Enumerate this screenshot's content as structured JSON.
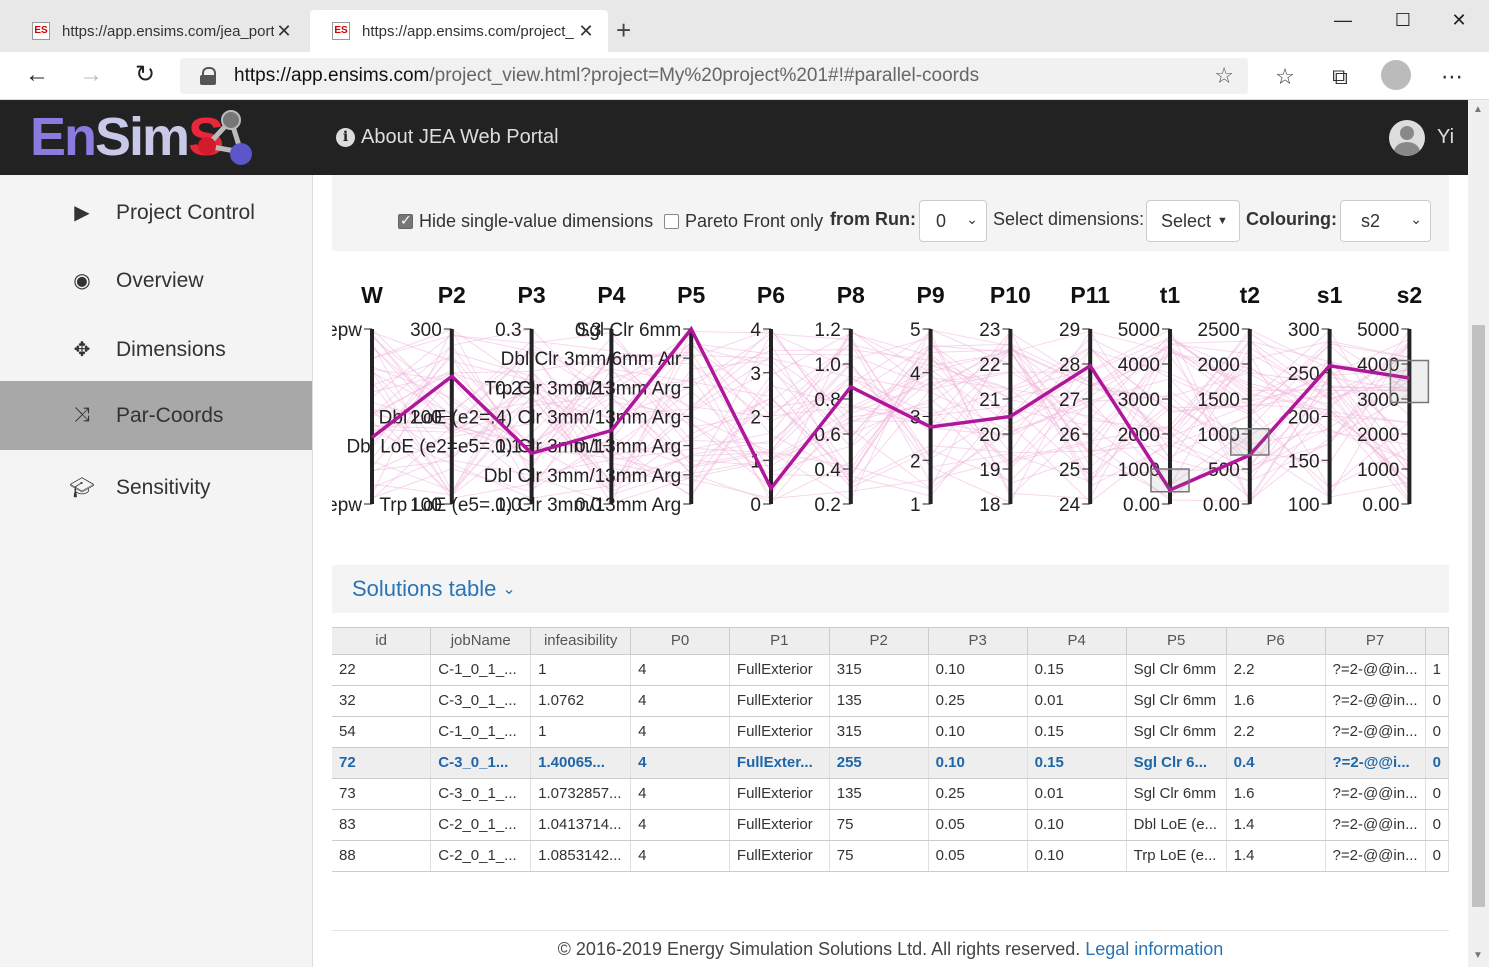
{
  "browser": {
    "tabs": [
      {
        "title": "https://app.ensims.com/jea_port",
        "favicon": "ES",
        "active": false
      },
      {
        "title": "https://app.ensims.com/project_",
        "favicon": "ES",
        "active": true
      }
    ],
    "url_host": "https://app.ensims.com",
    "url_path": "/project_view.html?project=My%20project%201#!#parallel-coords"
  },
  "header": {
    "logo": {
      "en": "En",
      "sim": "Sim",
      "s": "S"
    },
    "about_label": "About JEA Web Portal",
    "user": "Yi"
  },
  "sidebar": {
    "items": [
      {
        "label": "Project Control",
        "icon": "play-icon",
        "active": false
      },
      {
        "label": "Overview",
        "icon": "eye-icon",
        "active": false
      },
      {
        "label": "Dimensions",
        "icon": "move-icon",
        "active": false
      },
      {
        "label": "Par-Coords",
        "icon": "shuffle-icon",
        "active": true
      },
      {
        "label": "Sensitivity",
        "icon": "graduation-cap-icon",
        "active": false
      }
    ]
  },
  "controls": {
    "hide_single_label": "Hide single-value dimensions",
    "hide_single_checked": true,
    "pareto_label": "Pareto Front only",
    "pareto_checked": false,
    "from_run_label": "from Run:",
    "from_run_value": "0",
    "select_dims_label": "Select dimensions:",
    "select_button": "Select",
    "colouring_label": "Colouring:",
    "colouring_value": "s2"
  },
  "chart_data": {
    "type": "parallel-coordinates",
    "axes": [
      {
        "name": "W",
        "ticks": [
          "epw",
          "epw"
        ]
      },
      {
        "name": "P2",
        "ticks": [
          "300",
          "200",
          "100"
        ]
      },
      {
        "name": "P3",
        "ticks": [
          "0.3",
          "0.2",
          "0.1",
          "0.0"
        ]
      },
      {
        "name": "P4",
        "ticks": [
          "0.3",
          "0.2",
          "0.1",
          "0.0"
        ]
      },
      {
        "name": "P5",
        "ticks": [
          "Sgl Clr 6mm",
          "Dbl Clr 3mm/6mm Air",
          "Trp Clr 3mm/13mm Arg",
          "Dbl LoE (e2=.4) Clr 3mm/13mm Arg",
          "Dbl LoE (e2=e5=.1) Clr 3mm/13mm Arg",
          "Dbl Clr 3mm/13mm Arg",
          "Trp LoE (e5=.1) Clr 3mm/13mm Arg"
        ]
      },
      {
        "name": "P6",
        "ticks": [
          "4",
          "3",
          "2",
          "1",
          "0"
        ]
      },
      {
        "name": "P8",
        "ticks": [
          "1.2",
          "1.0",
          "0.8",
          "0.6",
          "0.4",
          "0.2"
        ]
      },
      {
        "name": "P9",
        "ticks": [
          "5",
          "4",
          "3",
          "2",
          "1"
        ]
      },
      {
        "name": "P10",
        "ticks": [
          "23",
          "22",
          "21",
          "20",
          "19",
          "18"
        ]
      },
      {
        "name": "P11",
        "ticks": [
          "29",
          "28",
          "27",
          "26",
          "25",
          "24"
        ]
      },
      {
        "name": "t1",
        "ticks": [
          "5000",
          "4000",
          "3000",
          "2000",
          "1000",
          "0.00"
        ]
      },
      {
        "name": "t2",
        "ticks": [
          "2500",
          "2000",
          "1500",
          "1000",
          "500",
          "0.00"
        ]
      },
      {
        "name": "s1",
        "ticks": [
          "300",
          "250",
          "200",
          "150",
          "100"
        ]
      },
      {
        "name": "s2",
        "ticks": [
          "5000",
          "4000",
          "3000",
          "2000",
          "1000",
          "0.00"
        ]
      }
    ],
    "highlighted_line_colour": "#b0169a",
    "background_line_colour": "#f0b6dc"
  },
  "solutions": {
    "toggle_label": "Solutions table",
    "columns": [
      "id",
      "jobName",
      "infeasibility",
      "P0",
      "P1",
      "P2",
      "P3",
      "P4",
      "P5",
      "P6",
      "P7",
      ""
    ],
    "rows": [
      {
        "cells": [
          "22",
          "C-1_0_1_...",
          "1",
          "4",
          "FullExterior",
          "315",
          "0.10",
          "0.15",
          "Sgl Clr 6mm",
          "2.2",
          "?=2-@@in...",
          "1"
        ],
        "highlight": false
      },
      {
        "cells": [
          "32",
          "C-3_0_1_...",
          "1.0762",
          "4",
          "FullExterior",
          "135",
          "0.25",
          "0.01",
          "Sgl Clr 6mm",
          "1.6",
          "?=2-@@in...",
          "0"
        ],
        "highlight": false
      },
      {
        "cells": [
          "54",
          "C-1_0_1_...",
          "1",
          "4",
          "FullExterior",
          "315",
          "0.10",
          "0.15",
          "Sgl Clr 6mm",
          "2.2",
          "?=2-@@in...",
          "0"
        ],
        "highlight": false
      },
      {
        "cells": [
          "72",
          "C-3_0_1...",
          "1.40065...",
          "4",
          "FullExter...",
          "255",
          "0.10",
          "0.15",
          "Sgl Clr 6...",
          "0.4",
          "?=2-@@i...",
          "0"
        ],
        "highlight": true
      },
      {
        "cells": [
          "73",
          "C-3_0_1_...",
          "1.0732857...",
          "4",
          "FullExterior",
          "135",
          "0.25",
          "0.01",
          "Sgl Clr 6mm",
          "1.6",
          "?=2-@@in...",
          "0"
        ],
        "highlight": false
      },
      {
        "cells": [
          "83",
          "C-2_0_1_...",
          "1.0413714...",
          "4",
          "FullExterior",
          "75",
          "0.05",
          "0.10",
          "Dbl LoE (e...",
          "1.4",
          "?=2-@@in...",
          "0"
        ],
        "highlight": false
      },
      {
        "cells": [
          "88",
          "C-2_0_1_...",
          "1.0853142...",
          "4",
          "FullExterior",
          "75",
          "0.05",
          "0.10",
          "Trp LoE (e...",
          "1.4",
          "?=2-@@in...",
          "0"
        ],
        "highlight": false
      }
    ]
  },
  "footer": {
    "copyright": "© 2016-2019 Energy Simulation Solutions Ltd. All rights reserved.",
    "legal_link": "Legal information"
  }
}
